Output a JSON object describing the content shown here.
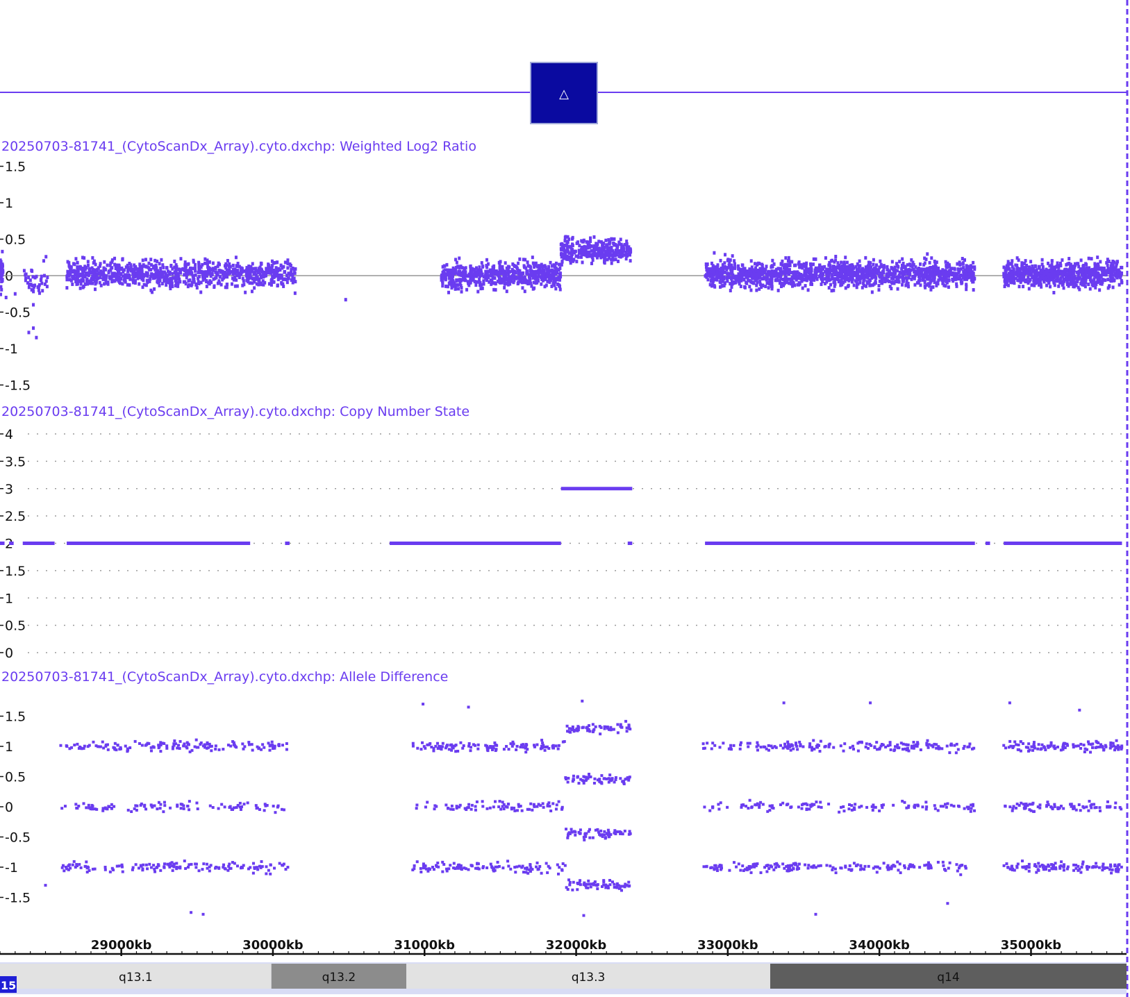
{
  "colors": {
    "accent": "#6a3cf0",
    "marker_fill": "#0a0aa0",
    "zero_line": "#808080",
    "grid_dot": "#9a9a9a"
  },
  "marker": {
    "icon": "delta-triangle-icon",
    "glyph": "△"
  },
  "chromosome": {
    "badge": "15"
  },
  "chart_data": [
    {
      "type": "scatter",
      "title": "20250703-81741_(CytoScanDx_Array).cyto.dxchp: Weighted Log2 Ratio",
      "yticks": [
        {
          "value": 1.5,
          "label": "1.5"
        },
        {
          "value": 1,
          "label": "1"
        },
        {
          "value": 0.5,
          "label": "0.5"
        },
        {
          "value": 0,
          "label": "0"
        },
        {
          "value": -0.5,
          "label": "-0.5"
        },
        {
          "value": -1,
          "label": "-1"
        },
        {
          "value": -1.5,
          "label": "-1.5"
        }
      ],
      "ylim": [
        -1.5,
        1.5
      ],
      "zero_line": true,
      "segments": [
        {
          "x_start": 28200,
          "x_end": 28220,
          "mean": 0.05,
          "spread": 0.35,
          "n": 40
        },
        {
          "x_start": 28360,
          "x_end": 28520,
          "mean": -0.05,
          "spread": 0.35,
          "n": 40
        },
        {
          "x_start": 28640,
          "x_end": 30150,
          "mean": 0.02,
          "spread": 0.22,
          "n": 900
        },
        {
          "x_start": 31110,
          "x_end": 31900,
          "mean": 0.0,
          "spread": 0.22,
          "n": 600
        },
        {
          "x_start": 31900,
          "x_end": 32360,
          "mean": 0.33,
          "spread": 0.2,
          "n": 320
        },
        {
          "x_start": 32850,
          "x_end": 34630,
          "mean": 0.02,
          "spread": 0.22,
          "n": 1400
        },
        {
          "x_start": 34820,
          "x_end": 35600,
          "mean": 0.02,
          "spread": 0.22,
          "n": 700
        }
      ]
    },
    {
      "type": "line",
      "title": "20250703-81741_(CytoScanDx_Array).cyto.dxchp: Copy Number State",
      "yticks": [
        {
          "value": 4,
          "label": "4"
        },
        {
          "value": 3.5,
          "label": "3.5"
        },
        {
          "value": 3,
          "label": "3"
        },
        {
          "value": 2.5,
          "label": "2.5"
        },
        {
          "value": 2,
          "label": "2"
        },
        {
          "value": 1.5,
          "label": "1.5"
        },
        {
          "value": 1,
          "label": "1"
        },
        {
          "value": 0.5,
          "label": "0.5"
        },
        {
          "value": 0,
          "label": "0"
        }
      ],
      "ylim": [
        0,
        4
      ],
      "grid": "dotted",
      "segments": [
        {
          "x_start": 28200,
          "x_end": 28230,
          "value": 2
        },
        {
          "x_start": 28260,
          "x_end": 28290,
          "value": 2
        },
        {
          "x_start": 28350,
          "x_end": 28560,
          "value": 2
        },
        {
          "x_start": 28640,
          "x_end": 29850,
          "value": 2
        },
        {
          "x_start": 30080,
          "x_end": 30110,
          "value": 2
        },
        {
          "x_start": 30770,
          "x_end": 31900,
          "value": 2
        },
        {
          "x_start": 31900,
          "x_end": 32370,
          "value": 3
        },
        {
          "x_start": 32340,
          "x_end": 32370,
          "value": 2
        },
        {
          "x_start": 32850,
          "x_end": 34630,
          "value": 2
        },
        {
          "x_start": 34700,
          "x_end": 34730,
          "value": 2
        },
        {
          "x_start": 34820,
          "x_end": 35600,
          "value": 2
        }
      ]
    },
    {
      "type": "scatter",
      "title": "20250703-81741_(CytoScanDx_Array).cyto.dxchp: Allele Difference",
      "yticks": [
        {
          "value": 1.5,
          "label": "1.5"
        },
        {
          "value": 1,
          "label": "1"
        },
        {
          "value": 0.5,
          "label": "0.5"
        },
        {
          "value": 0,
          "label": "0"
        },
        {
          "value": -0.5,
          "label": "-0.5"
        },
        {
          "value": -1,
          "label": "-1"
        },
        {
          "value": -1.5,
          "label": "-1.5"
        }
      ],
      "ylim": [
        -2,
        2
      ],
      "segments": [
        {
          "x_start": 28600,
          "x_end": 30100,
          "bands": [
            1,
            0,
            -1
          ],
          "n": 140
        },
        {
          "x_start": 30920,
          "x_end": 31930,
          "bands": [
            1,
            0,
            -1
          ],
          "n": 110
        },
        {
          "x_start": 31930,
          "x_end": 32360,
          "bands": [
            1.3,
            0.45,
            -0.45,
            -1.3
          ],
          "n": 60
        },
        {
          "x_start": 32830,
          "x_end": 34630,
          "bands": [
            1,
            0,
            -1
          ],
          "n": 170
        },
        {
          "x_start": 34820,
          "x_end": 35600,
          "bands": [
            1,
            0,
            -1
          ],
          "n": 110
        }
      ]
    }
  ],
  "genome_axis": {
    "xlim": [
      28200,
      35630
    ],
    "ticks": [
      {
        "value": 29000,
        "label": "29000kb"
      },
      {
        "value": 30000,
        "label": "30000kb"
      },
      {
        "value": 31000,
        "label": "31000kb"
      },
      {
        "value": 32000,
        "label": "32000kb"
      },
      {
        "value": 33000,
        "label": "33000kb"
      },
      {
        "value": 34000,
        "label": "34000kb"
      },
      {
        "value": 35000,
        "label": "35000kb"
      }
    ]
  },
  "ideogram": {
    "bands": [
      {
        "label": "q13.1",
        "start": 28200,
        "end": 29990,
        "shade": "#e2e2e2"
      },
      {
        "label": "q13.2",
        "start": 29990,
        "end": 30880,
        "shade": "#8c8c8c"
      },
      {
        "label": "q13.3",
        "start": 30880,
        "end": 33280,
        "shade": "#e2e2e2"
      },
      {
        "label": "q14",
        "start": 33280,
        "end": 35630,
        "shade": "#5e5e5e"
      }
    ]
  }
}
